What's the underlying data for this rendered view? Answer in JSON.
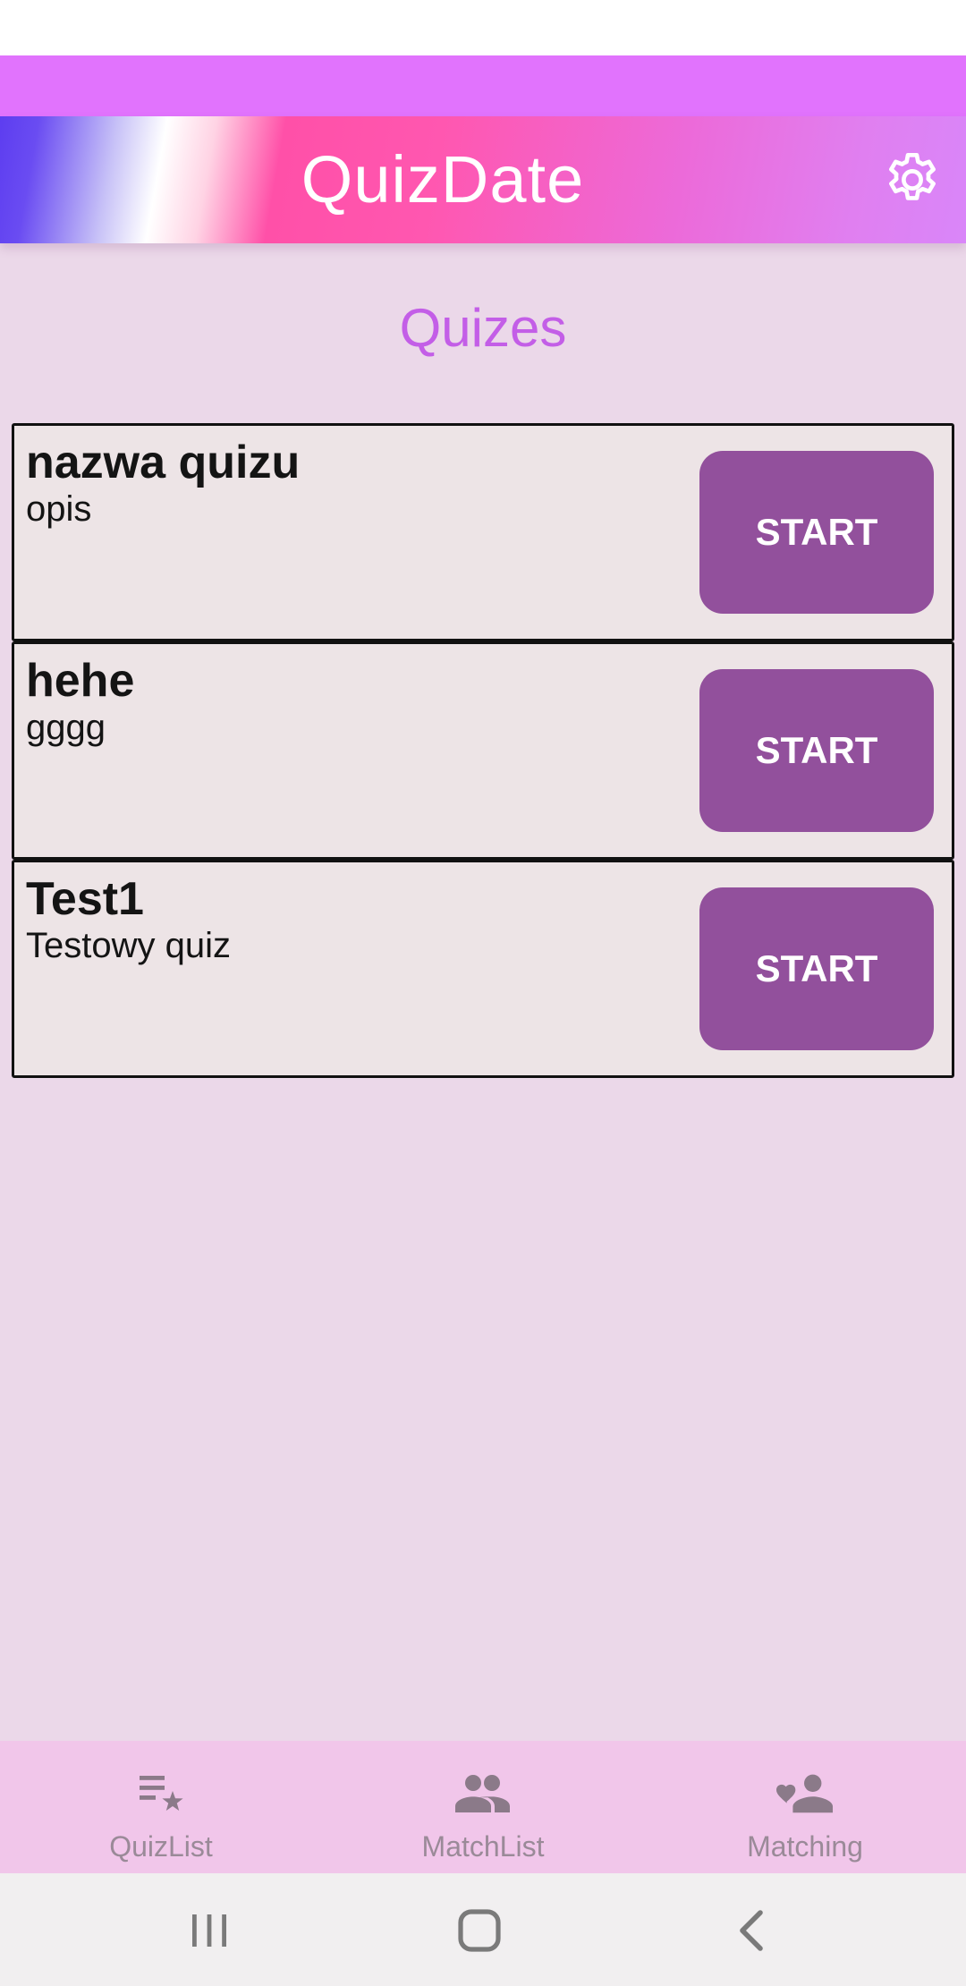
{
  "app": {
    "title": "QuizDate",
    "colors": {
      "header_strip": "#e173fd",
      "background": "#ebd8e9",
      "section_title": "#c35ee7",
      "start_button": "#92509c",
      "bottom_nav": "#f1c6ea"
    }
  },
  "header": {
    "title": "QuizDate",
    "settings_icon": "gear-icon"
  },
  "main": {
    "section_title": "Quizes",
    "quizzes": [
      {
        "name": "nazwa quizu",
        "description": "opis",
        "button_label": "START"
      },
      {
        "name": "hehe",
        "description": "gggg",
        "button_label": "START"
      },
      {
        "name": "Test1",
        "description": "Testowy quiz",
        "button_label": "START"
      }
    ]
  },
  "bottom_nav": {
    "items": [
      {
        "label": "QuizList",
        "icon": "playlist-star-icon"
      },
      {
        "label": "MatchList",
        "icon": "people-icon"
      },
      {
        "label": "Matching",
        "icon": "person-heart-icon"
      }
    ]
  },
  "system_nav": {
    "items": [
      "recents-icon",
      "home-icon",
      "back-icon"
    ]
  }
}
